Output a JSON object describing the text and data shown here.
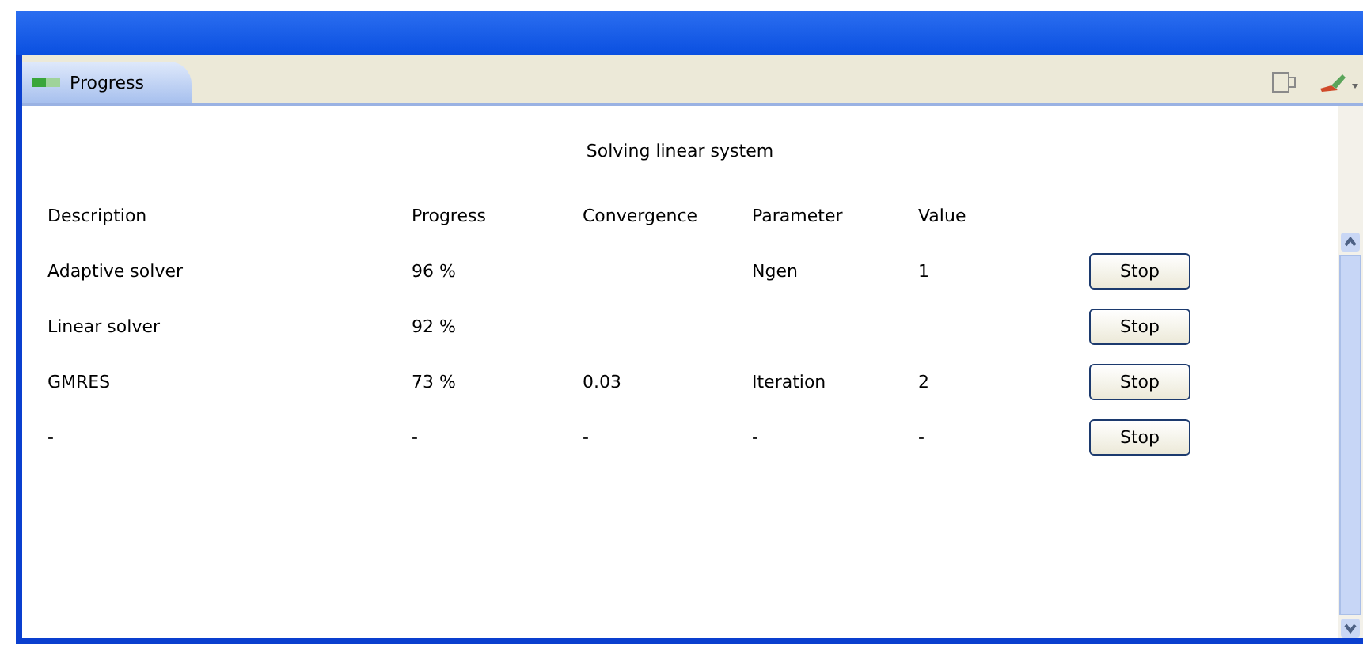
{
  "tab": {
    "label": "Progress",
    "selected": true
  },
  "heading": "Solving linear system",
  "table": {
    "columns": [
      "Description",
      "Progress",
      "Convergence",
      "Parameter",
      "Value"
    ],
    "rows": [
      {
        "cells": [
          "Adaptive solver",
          "96 %",
          "",
          "Ngen",
          "1"
        ],
        "button": "Stop"
      },
      {
        "cells": [
          "Linear solver",
          "92 %",
          "",
          "",
          ""
        ],
        "button": "Stop"
      },
      {
        "cells": [
          "GMRES",
          "73 %",
          "0.03",
          "Iteration",
          "2"
        ],
        "button": "Stop"
      },
      {
        "cells": [
          "-",
          "-",
          "-",
          "-",
          "-"
        ],
        "button": "Stop"
      }
    ]
  }
}
